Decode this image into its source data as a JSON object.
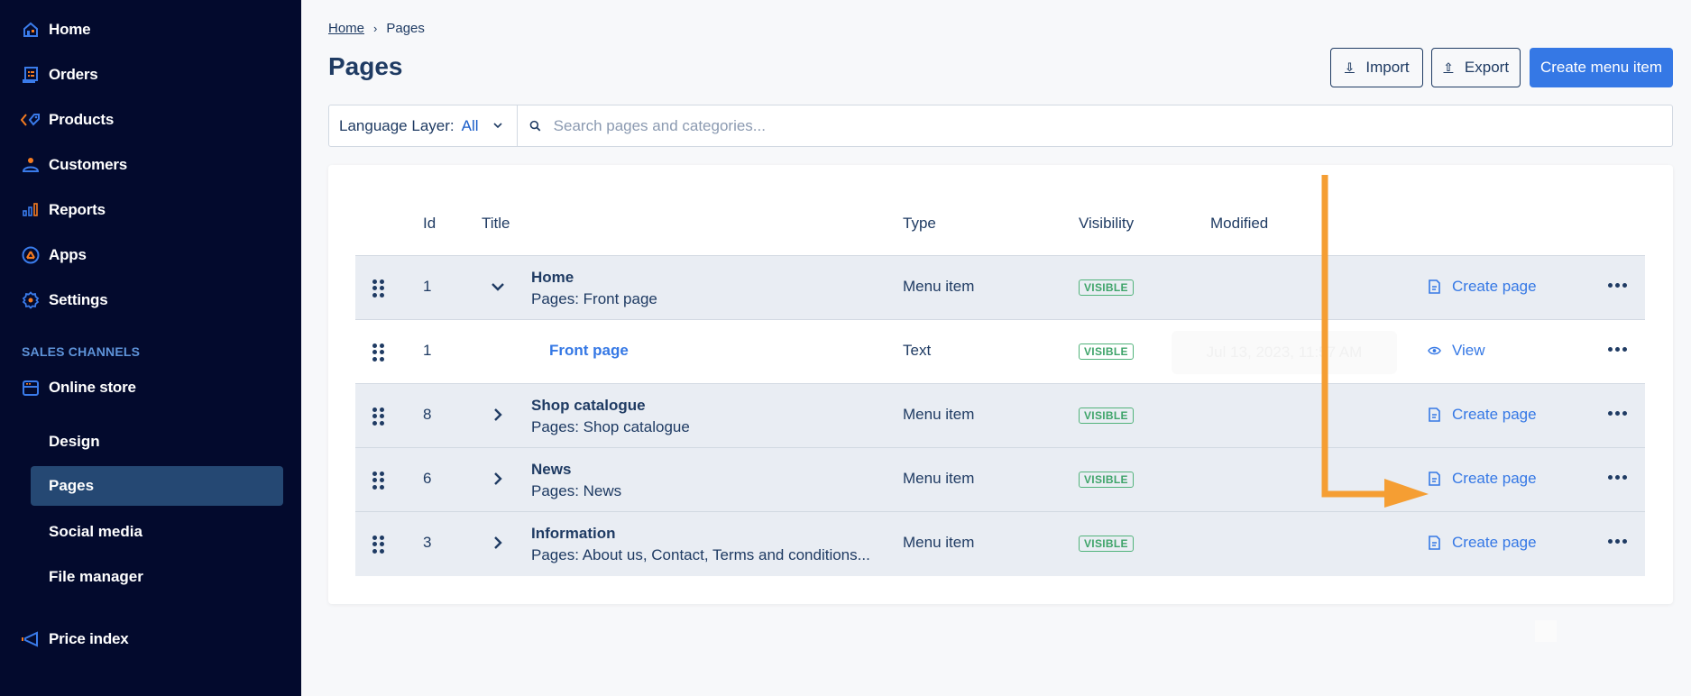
{
  "sidebar": {
    "items": [
      {
        "label": "Home",
        "icon": "home-icon"
      },
      {
        "label": "Orders",
        "icon": "orders-icon"
      },
      {
        "label": "Products",
        "icon": "tag-icon"
      },
      {
        "label": "Customers",
        "icon": "person-icon"
      },
      {
        "label": "Reports",
        "icon": "bar-chart-icon"
      },
      {
        "label": "Apps",
        "icon": "apps-icon"
      },
      {
        "label": "Settings",
        "icon": "gear-icon"
      }
    ],
    "section_label": "SALES CHANNELS",
    "channel": {
      "label": "Online store",
      "icon": "store-icon"
    },
    "sub_items": [
      {
        "label": "Design",
        "active": false
      },
      {
        "label": "Pages",
        "active": true
      },
      {
        "label": "Social media",
        "active": false
      },
      {
        "label": "File manager",
        "active": false
      }
    ],
    "price_index": {
      "label": "Price index",
      "icon": "megaphone-icon"
    }
  },
  "breadcrumb": {
    "home": "Home",
    "separator": "›",
    "current": "Pages"
  },
  "page_title": "Pages",
  "toolbar": {
    "import_label": "Import",
    "export_label": "Export",
    "create_label": "Create menu item"
  },
  "filter": {
    "language_label": "Language Layer:",
    "language_value": "All",
    "search_placeholder": "Search pages and categories..."
  },
  "table": {
    "headers": {
      "id": "Id",
      "title": "Title",
      "type": "Type",
      "visibility": "Visibility",
      "modified": "Modified"
    },
    "rows": [
      {
        "id": "1",
        "title": "Home",
        "subtitle": "Pages: Front page",
        "type": "Menu item",
        "visibility": "VISIBLE",
        "action": "Create page",
        "expanded": true
      },
      {
        "id": "1",
        "title": "Front page",
        "type": "Text",
        "visibility": "VISIBLE",
        "modified": "Jul 13, 2023, 11:57 AM",
        "action": "View"
      },
      {
        "id": "8",
        "title": "Shop catalogue",
        "subtitle": "Pages: Shop catalogue",
        "type": "Menu item",
        "visibility": "VISIBLE",
        "action": "Create page",
        "expanded": false
      },
      {
        "id": "6",
        "title": "News",
        "subtitle": "Pages: News",
        "type": "Menu item",
        "visibility": "VISIBLE",
        "action": "Create page",
        "expanded": false
      },
      {
        "id": "3",
        "title": "Information",
        "subtitle": "Pages: About us, Contact, Terms and conditions...",
        "type": "Menu item",
        "visibility": "VISIBLE",
        "action": "Create page",
        "expanded": false
      }
    ]
  },
  "colors": {
    "sidebar_bg": "#030a2d",
    "accent": "#3578e5",
    "text": "#1f3b63",
    "visible_badge": "#3fa46a",
    "annotation_arrow": "#f59e33"
  }
}
